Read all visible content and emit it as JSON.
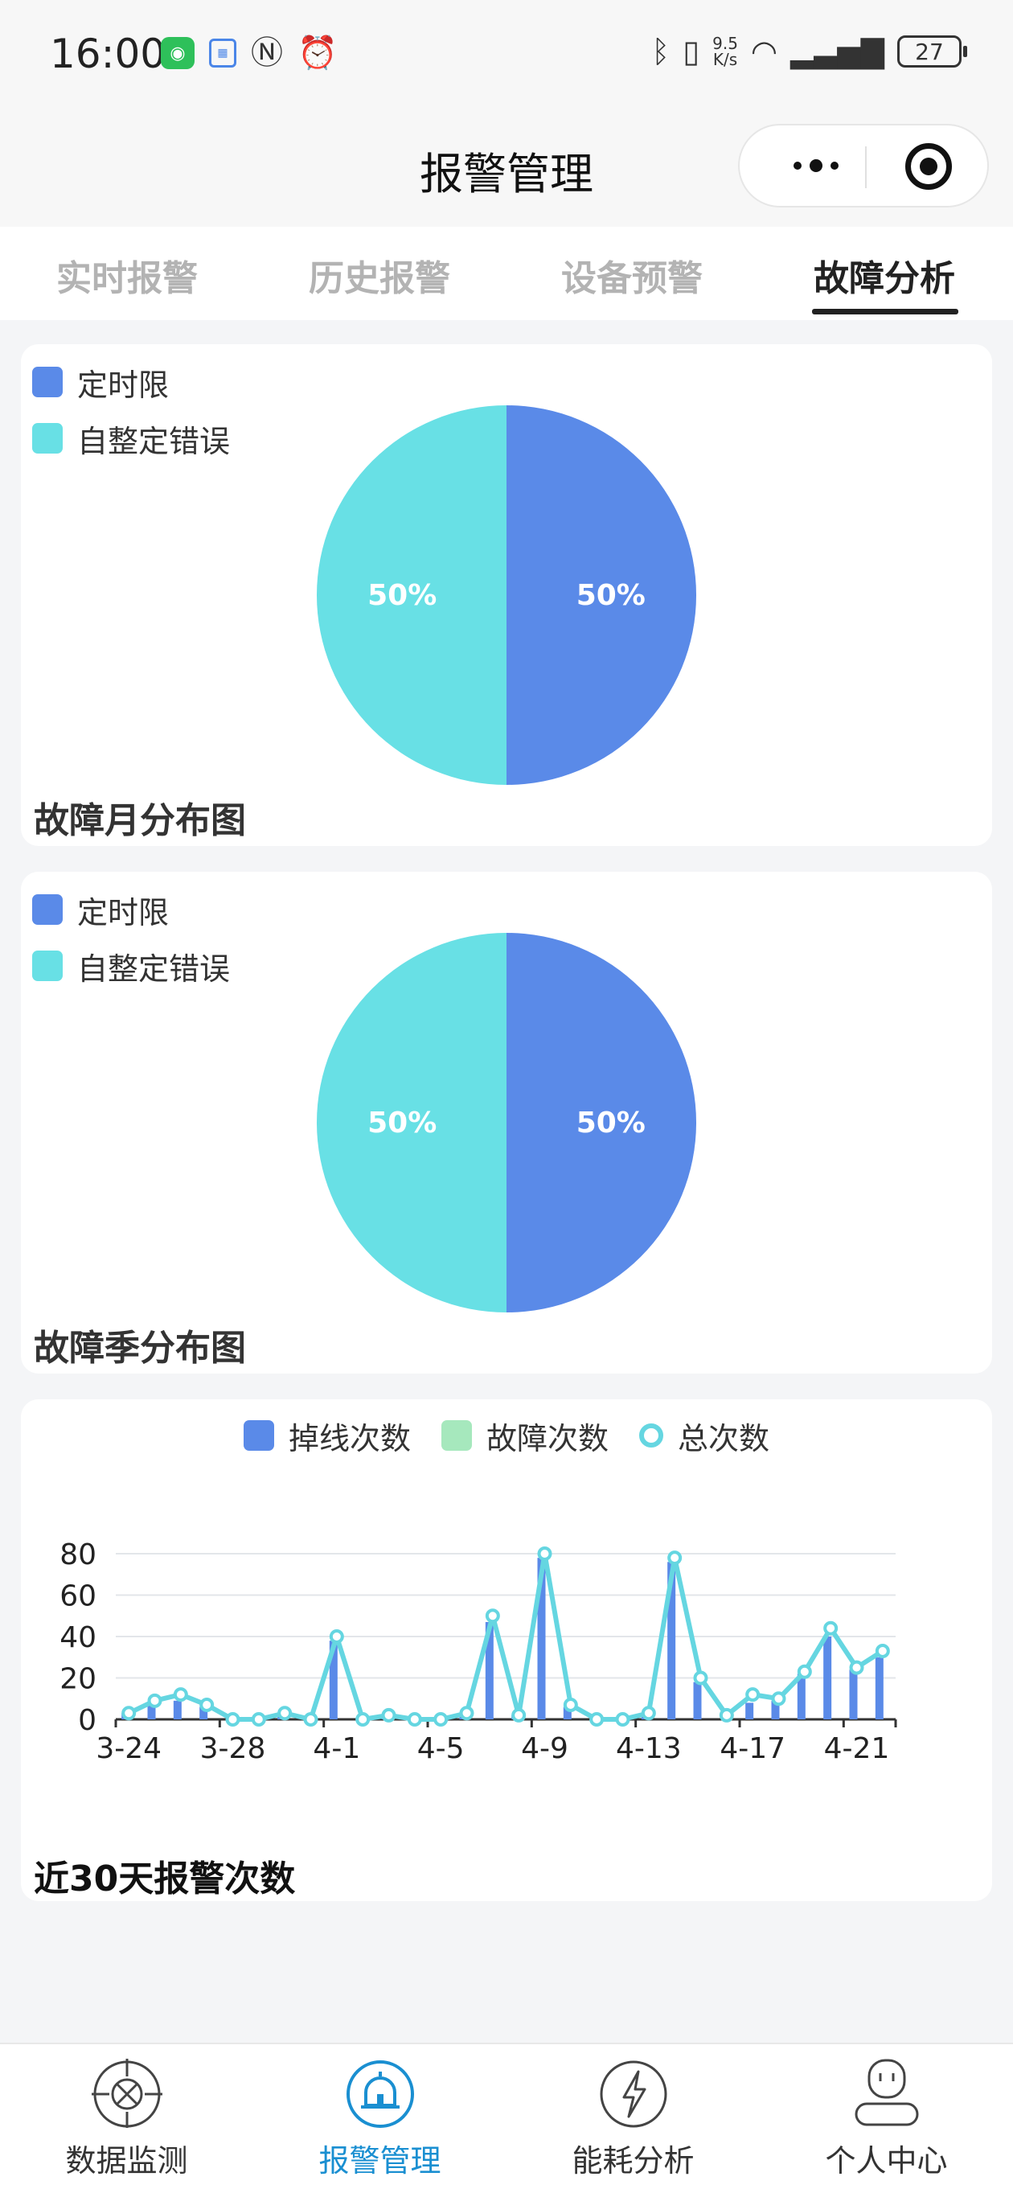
{
  "status_bar": {
    "time": "16:00",
    "net_speed_value": "9.5",
    "net_speed_unit": "K/s",
    "battery": "27"
  },
  "header": {
    "title": "报警管理"
  },
  "tabs": [
    {
      "label": "实时报警",
      "active": false
    },
    {
      "label": "历史报警",
      "active": false
    },
    {
      "label": "设备预警",
      "active": false
    },
    {
      "label": "故障分析",
      "active": true
    }
  ],
  "colors": {
    "blue": "#5a8ae8",
    "cyan": "#68e0e5",
    "green": "#a6e8bd",
    "line": "#65d6e1",
    "accent": "#1a8fd1"
  },
  "pie_month": {
    "title": "故障月分布图",
    "legend": [
      "定时限",
      "自整定错误"
    ]
  },
  "pie_quarter": {
    "title": "故障季分布图",
    "legend": [
      "定时限",
      "自整定错误"
    ]
  },
  "trend": {
    "title": "近30天报警次数",
    "legend": [
      "掉线次数",
      "故障次数",
      "总次数"
    ]
  },
  "chart_data": [
    {
      "type": "pie",
      "labels": [
        "定时限",
        "自整定错误"
      ],
      "values": [
        50,
        50
      ],
      "data_labels": [
        "50%",
        "50%"
      ]
    },
    {
      "type": "pie",
      "labels": [
        "定时限",
        "自整定错误"
      ],
      "values": [
        50,
        50
      ],
      "data_labels": [
        "50%",
        "50%"
      ]
    },
    {
      "type": "bar",
      "x": [
        "3-24",
        "3-25",
        "3-26",
        "3-27",
        "3-28",
        "3-29",
        "3-30",
        "3-31",
        "4-1",
        "4-2",
        "4-3",
        "4-4",
        "4-5",
        "4-6",
        "4-7",
        "4-8",
        "4-9",
        "4-10",
        "4-11",
        "4-12",
        "4-13",
        "4-14",
        "4-15",
        "4-16",
        "4-17",
        "4-18",
        "4-19",
        "4-20",
        "4-21",
        "4-22"
      ],
      "tick_labels": [
        "3-24",
        "3-28",
        "4-1",
        "4-5",
        "4-9",
        "4-13",
        "4-17",
        "4-21"
      ],
      "ylim": [
        0,
        80
      ],
      "yticks": [
        0,
        20,
        40,
        60,
        80
      ],
      "grid": true,
      "legend_position": "top-center",
      "series": [
        {
          "name": "掉线次数",
          "type": "bar",
          "values": [
            3,
            7,
            9,
            6,
            0,
            0,
            2,
            0,
            38,
            0,
            2,
            0,
            0,
            2,
            47,
            2,
            78,
            6,
            0,
            0,
            2,
            76,
            18,
            0,
            8,
            9,
            22,
            40,
            24,
            30
          ]
        },
        {
          "name": "故障次数",
          "type": "bar",
          "values": [
            0,
            0,
            0,
            0,
            0,
            0,
            0,
            0,
            0,
            0,
            0,
            0,
            0,
            0,
            0,
            0,
            0,
            0,
            0,
            0,
            0,
            0,
            0,
            0,
            0,
            0,
            0,
            0,
            0,
            0
          ]
        },
        {
          "name": "总次数",
          "type": "line",
          "values": [
            3,
            9,
            12,
            7,
            0,
            0,
            3,
            0,
            40,
            0,
            2,
            0,
            0,
            3,
            50,
            2,
            80,
            7,
            0,
            0,
            3,
            78,
            20,
            2,
            12,
            10,
            23,
            44,
            25,
            33
          ]
        }
      ]
    }
  ],
  "bottom_nav": [
    {
      "label": "数据监测",
      "icon": "crosshair-icon",
      "active": false
    },
    {
      "label": "报警管理",
      "icon": "alarm-light-icon",
      "active": true
    },
    {
      "label": "能耗分析",
      "icon": "lightning-icon",
      "active": false
    },
    {
      "label": "个人中心",
      "icon": "user-icon",
      "active": false
    }
  ]
}
